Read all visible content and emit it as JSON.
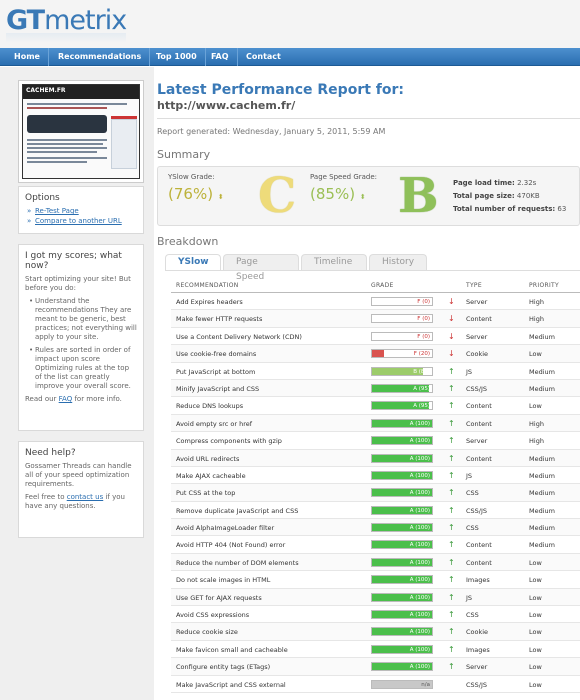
{
  "logo": {
    "gt": "GT",
    "metrix": "metrix"
  },
  "nav": [
    "Home",
    "Recommendations",
    "Top 1000",
    "FAQ",
    "Contact"
  ],
  "thumbnail": {
    "brand": "CACHEM.FR"
  },
  "options": {
    "title": "Options",
    "links": [
      "Re-Test Page",
      "Compare to another URL"
    ]
  },
  "scores_help": {
    "title": "I got my scores; what now?",
    "intro": "Start optimizing your site! But before you do:",
    "bullets": [
      "Understand the recommendations They are meant to be generic, best practices; not everything will apply to your site.",
      "Rules are sorted in order of impact upon score Optimizing rules at the top of the list can greatly improve your overall score."
    ],
    "read_prefix": "Read our",
    "read_link": "FAQ",
    "read_suffix": "for more info."
  },
  "need_help": {
    "title": "Need help?",
    "text": "Gossamer Threads can handle all of your speed optimization requirements.",
    "feel_prefix": "Feel free to",
    "feel_link": "contact us",
    "feel_suffix": "if you have any questions."
  },
  "report": {
    "title": "Latest Performance Report for:",
    "url": "http://www.cachem.fr/",
    "generated": "Report generated: Wednesday, January 5, 2011, 5:59 AM"
  },
  "summary": {
    "title": "Summary",
    "yslow_label": "YSlow Grade:",
    "yslow_value": "(76%)",
    "yslow_letter": "C",
    "pagespeed_label": "Page Speed Grade:",
    "pagespeed_value": "(85%)",
    "pagespeed_letter": "B",
    "arrow": "⬍",
    "load_label": "Page load time:",
    "load_value": "2.32s",
    "size_label": "Total page size:",
    "size_value": "470KB",
    "requests_label": "Total number of requests:",
    "requests_value": "63"
  },
  "breakdown": {
    "title": "Breakdown",
    "tabs": [
      "YSlow",
      "Page Speed",
      "Timeline",
      "History"
    ],
    "headers": [
      "RECOMMENDATION",
      "GRADE",
      "TYPE",
      "PRIORITY"
    ],
    "rows": [
      {
        "name": "Add Expires headers",
        "grade": "F (0)",
        "score": 0,
        "dir": "down",
        "type": "Server",
        "priority": "High"
      },
      {
        "name": "Make fewer HTTP requests",
        "grade": "F (0)",
        "score": 0,
        "dir": "down",
        "type": "Content",
        "priority": "High"
      },
      {
        "name": "Use a Content Delivery Network (CDN)",
        "grade": "F (0)",
        "score": 0,
        "dir": "down",
        "type": "Server",
        "priority": "Medium"
      },
      {
        "name": "Use cookie-free domains",
        "grade": "F (20)",
        "score": 20,
        "dir": "down",
        "type": "Cookie",
        "priority": "Low"
      },
      {
        "name": "Put JavaScript at bottom",
        "grade": "B (85)",
        "score": 85,
        "dir": "up",
        "type": "JS",
        "priority": "Medium"
      },
      {
        "name": "Minify JavaScript and CSS",
        "grade": "A (95)",
        "score": 95,
        "dir": "up",
        "type": "CSS/JS",
        "priority": "Medium"
      },
      {
        "name": "Reduce DNS lookups",
        "grade": "A (95)",
        "score": 95,
        "dir": "up",
        "type": "Content",
        "priority": "Low"
      },
      {
        "name": "Avoid empty src or href",
        "grade": "A (100)",
        "score": 100,
        "dir": "up",
        "type": "Content",
        "priority": "High"
      },
      {
        "name": "Compress components with gzip",
        "grade": "A (100)",
        "score": 100,
        "dir": "up",
        "type": "Server",
        "priority": "High"
      },
      {
        "name": "Avoid URL redirects",
        "grade": "A (100)",
        "score": 100,
        "dir": "up",
        "type": "Content",
        "priority": "Medium"
      },
      {
        "name": "Make AJAX cacheable",
        "grade": "A (100)",
        "score": 100,
        "dir": "up",
        "type": "JS",
        "priority": "Medium"
      },
      {
        "name": "Put CSS at the top",
        "grade": "A (100)",
        "score": 100,
        "dir": "up",
        "type": "CSS",
        "priority": "Medium"
      },
      {
        "name": "Remove duplicate JavaScript and CSS",
        "grade": "A (100)",
        "score": 100,
        "dir": "up",
        "type": "CSS/JS",
        "priority": "Medium"
      },
      {
        "name": "Avoid AlphaImageLoader filter",
        "grade": "A (100)",
        "score": 100,
        "dir": "up",
        "type": "CSS",
        "priority": "Medium"
      },
      {
        "name": "Avoid HTTP 404 (Not Found) error",
        "grade": "A (100)",
        "score": 100,
        "dir": "up",
        "type": "Content",
        "priority": "Medium"
      },
      {
        "name": "Reduce the number of DOM elements",
        "grade": "A (100)",
        "score": 100,
        "dir": "up",
        "type": "Content",
        "priority": "Low"
      },
      {
        "name": "Do not scale images in HTML",
        "grade": "A (100)",
        "score": 100,
        "dir": "up",
        "type": "Images",
        "priority": "Low"
      },
      {
        "name": "Use GET for AJAX requests",
        "grade": "A (100)",
        "score": 100,
        "dir": "up",
        "type": "JS",
        "priority": "Low"
      },
      {
        "name": "Avoid CSS expressions",
        "grade": "A (100)",
        "score": 100,
        "dir": "up",
        "type": "CSS",
        "priority": "Low"
      },
      {
        "name": "Reduce cookie size",
        "grade": "A (100)",
        "score": 100,
        "dir": "up",
        "type": "Cookie",
        "priority": "Low"
      },
      {
        "name": "Make favicon small and cacheable",
        "grade": "A (100)",
        "score": 100,
        "dir": "up",
        "type": "Images",
        "priority": "Low"
      },
      {
        "name": "Configure entity tags (ETags)",
        "grade": "A (100)",
        "score": 100,
        "dir": "up",
        "type": "Server",
        "priority": "Low"
      },
      {
        "name": "Make JavaScript and CSS external",
        "grade": "n/a",
        "score": 100,
        "dir": "none",
        "type": "CSS/JS",
        "priority": "Low"
      }
    ]
  },
  "colors": {
    "brand_blue": "#3a79b6",
    "grade_c": "#e6d874",
    "grade_b": "#8cbf5a",
    "fill_red": "#d9534f",
    "fill_green": "#4bbf4b",
    "fill_na": "#c8c8c8",
    "arrow_up": "#3a9a3a",
    "arrow_down": "#cc3333"
  }
}
